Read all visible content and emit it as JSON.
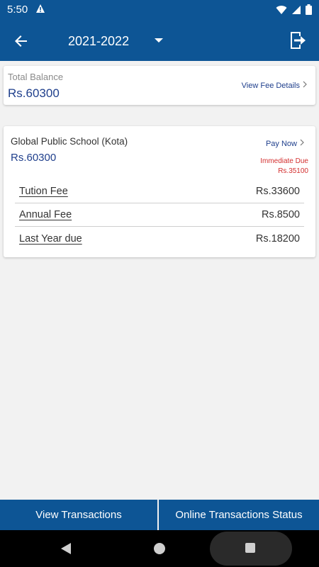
{
  "status_bar": {
    "time": "5:50",
    "icons": [
      "warning-icon",
      "wifi-icon",
      "signal-icon",
      "battery-icon"
    ]
  },
  "app_bar": {
    "year": "2021-2022",
    "back_icon": "arrow-left-icon",
    "logout_icon": "logout-icon"
  },
  "balance": {
    "label": "Total Balance",
    "value": "Rs.60300",
    "link_label": "View Fee Details"
  },
  "school": {
    "name": "Global Public School (Kota)",
    "amount": "Rs.60300",
    "pay_label": "Pay Now",
    "due_label": "Immediate Due",
    "due_amount": "Rs.35100",
    "fees": [
      {
        "name": "Tution Fee",
        "amount": "Rs.33600"
      },
      {
        "name": "Annual Fee",
        "amount": "Rs.8500"
      },
      {
        "name": "Last Year due",
        "amount": "Rs.18200"
      }
    ]
  },
  "bottom": {
    "left_label": "View Transactions",
    "right_label": "Online Transactions Status"
  },
  "colors": {
    "primary": "#0d5595",
    "amount_text": "#1f3f8c",
    "due_text": "#d32f2f",
    "background": "#f2f2f2"
  }
}
